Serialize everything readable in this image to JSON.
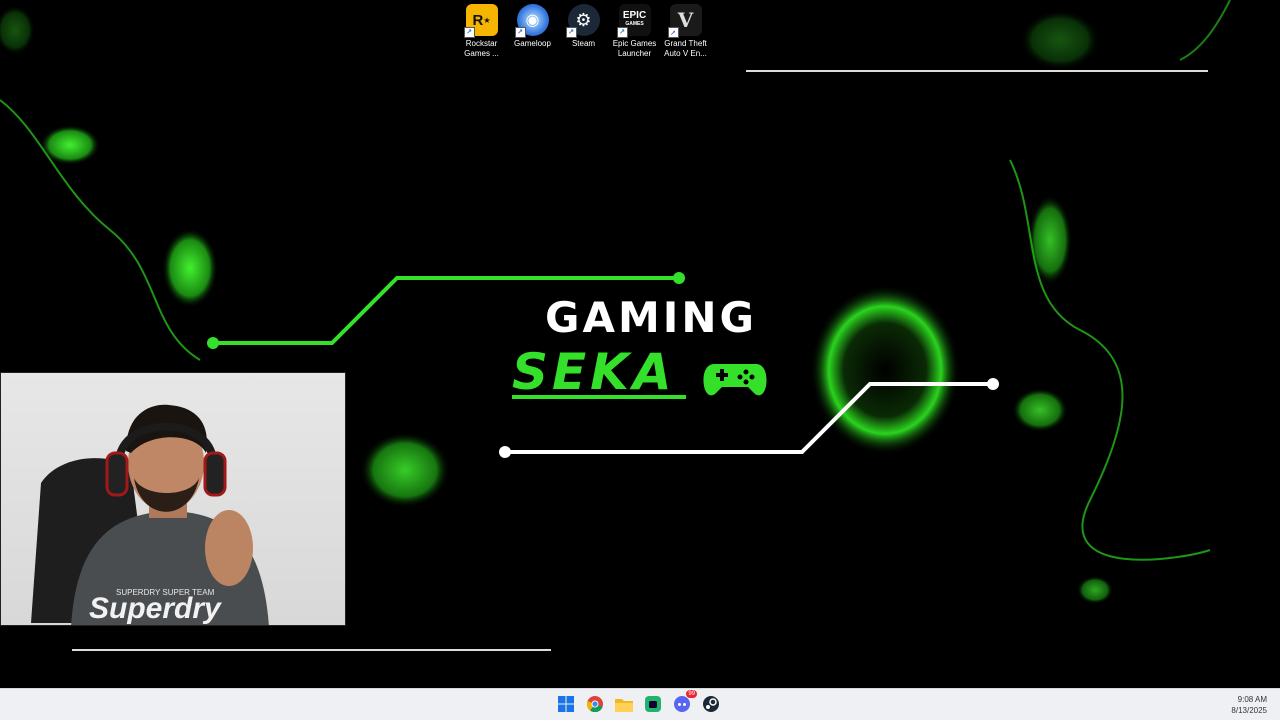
{
  "desktop": {
    "icons": [
      {
        "label": "Rockstar Games ...",
        "glyph": "R★",
        "icon": "rockstar-icon",
        "bg": "#f6b500",
        "fg": "#111"
      },
      {
        "label": "Gameloop",
        "glyph": "◉",
        "icon": "gameloop-icon",
        "bg": "#3a7be0",
        "fg": "#dff"
      },
      {
        "label": "Steam",
        "glyph": "⚙",
        "icon": "steam-icon",
        "bg": "#1b2838",
        "fg": "#fff"
      },
      {
        "label": "Epic Games Launcher",
        "glyph": "EPIC",
        "icon": "epic-games-icon",
        "bg": "#111",
        "fg": "#fff"
      },
      {
        "label": "Grand Theft Auto V En...",
        "glyph": "V",
        "icon": "gta-v-icon",
        "bg": "#222",
        "fg": "#ddd"
      }
    ]
  },
  "wallpaper": {
    "line1": "GAMING",
    "line2": "SEKA",
    "accent": "#35e02a"
  },
  "webcam": {
    "shirt_line1": "SUPERDRY SUPER TEAM",
    "shirt_line2": "Superdry"
  },
  "taskbar": {
    "apps": [
      {
        "name": "start-button",
        "icon": "windows-icon"
      },
      {
        "name": "taskbar-chrome",
        "icon": "chrome-icon"
      },
      {
        "name": "taskbar-file-explorer",
        "icon": "folder-icon"
      },
      {
        "name": "taskbar-app-green",
        "icon": "green-app-icon"
      },
      {
        "name": "taskbar-discord",
        "icon": "discord-icon",
        "badge": "99"
      },
      {
        "name": "taskbar-steam",
        "icon": "steam-icon"
      }
    ],
    "time": "9:08 AM",
    "date": "8/13/2025"
  }
}
